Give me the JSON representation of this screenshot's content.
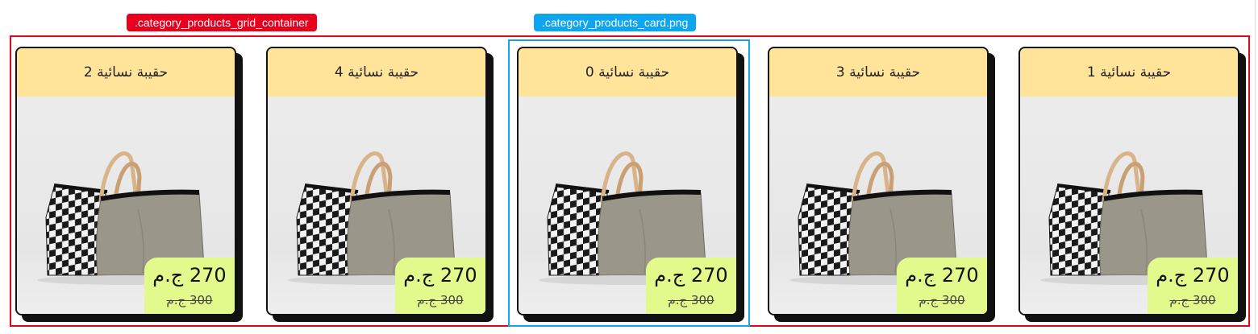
{
  "overlay_labels": {
    "grid_container": ".category_products_grid_container",
    "card_file": ".category_products_card.png"
  },
  "colors": {
    "grid_outline": "#e8001c",
    "card_outline": "#18a0f0",
    "title_bar": "#ffe49a",
    "price_bg": "#e2f98c"
  },
  "products": [
    {
      "title": "حقيبة نسائية 2",
      "price": "270 ج.م",
      "old_price": "300 ج.م"
    },
    {
      "title": "حقيبة نسائية 4",
      "price": "270 ج.م",
      "old_price": "300 ج.م"
    },
    {
      "title": "حقيبة نسائية 0",
      "price": "270 ج.م",
      "old_price": "300 ج.م"
    },
    {
      "title": "حقيبة نسائية 3",
      "price": "270 ج.م",
      "old_price": "300 ج.م"
    },
    {
      "title": "حقيبة نسائية 1",
      "price": "270 ج.م",
      "old_price": "300 ج.م"
    }
  ]
}
